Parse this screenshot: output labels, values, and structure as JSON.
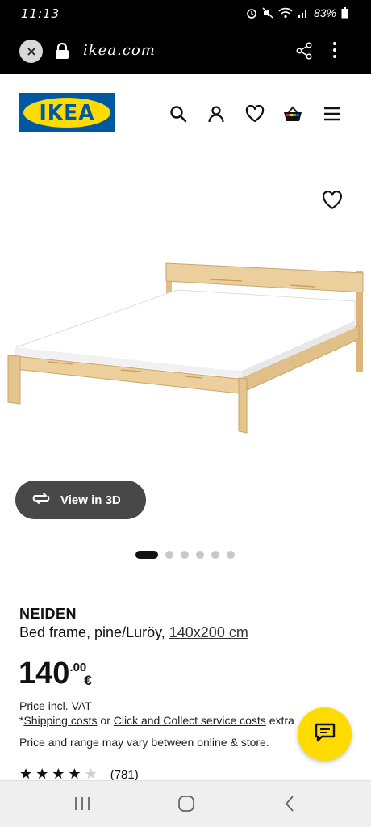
{
  "status_bar": {
    "time": "11:13",
    "battery": "83%",
    "icons": [
      "alarm-icon",
      "mute-icon",
      "wifi-icon",
      "signal-icon",
      "battery-icon"
    ]
  },
  "browser": {
    "url": "ikea.com",
    "icons": [
      "close-icon",
      "lock-icon",
      "share-icon",
      "more-vertical-icon"
    ]
  },
  "header": {
    "logo_text": "IKEA",
    "icons": [
      "search-icon",
      "account-icon",
      "heart-icon",
      "basket-icon",
      "menu-icon"
    ]
  },
  "product": {
    "name": "NEIDEN",
    "description": "Bed frame, pine/Luröy, ",
    "size": "140x200 cm",
    "price_whole": "140",
    "price_decimal": ".00",
    "currency": "€",
    "vat_text": "Price incl. VAT",
    "shipping_prefix": "*",
    "shipping_link": "Shipping costs",
    "shipping_or": " or ",
    "click_collect_link": "Click and Collect service costs",
    "shipping_suffix": " extra",
    "range_note": "Price and range may vary between online & store.",
    "rating_value": 4,
    "rating_max": 5,
    "rating_count": "(781)"
  },
  "gallery": {
    "view_3d_label": "View in 3D",
    "image_count": 6,
    "active_index": 0
  },
  "colors": {
    "ikea_blue": "#0058a3",
    "ikea_yellow": "#ffdb00",
    "button_dark": "#484848"
  }
}
